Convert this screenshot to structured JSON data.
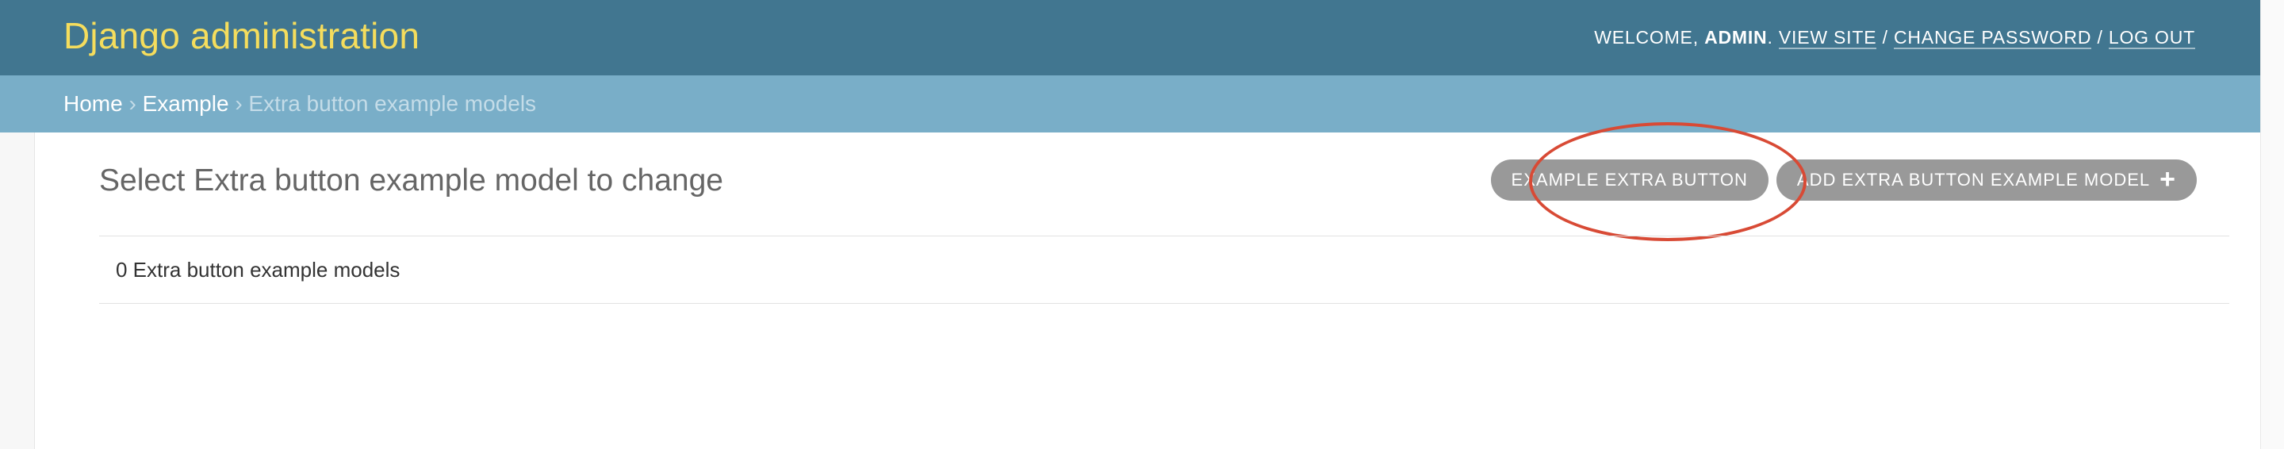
{
  "header": {
    "branding": "Django administration",
    "welcome_prefix": "Welcome, ",
    "username": "admin",
    "username_suffix": ".",
    "view_site": "View site",
    "change_password": "Change password",
    "log_out": "Log out",
    "separator": "/"
  },
  "breadcrumbs": {
    "home": "Home",
    "app": "Example",
    "current": "Extra button example models",
    "arrow": "›"
  },
  "content": {
    "title": "Select Extra button example model to change",
    "extra_button": "Example extra button",
    "add_button": "Add extra button example model",
    "add_icon": "+",
    "result_count": "0 Extra button example models"
  },
  "colors": {
    "header_bg": "#417690",
    "branding": "#f5dd5d",
    "breadcrumbs_bg": "#79aec8",
    "button_bg": "#999999",
    "highlight": "#d84a35"
  }
}
